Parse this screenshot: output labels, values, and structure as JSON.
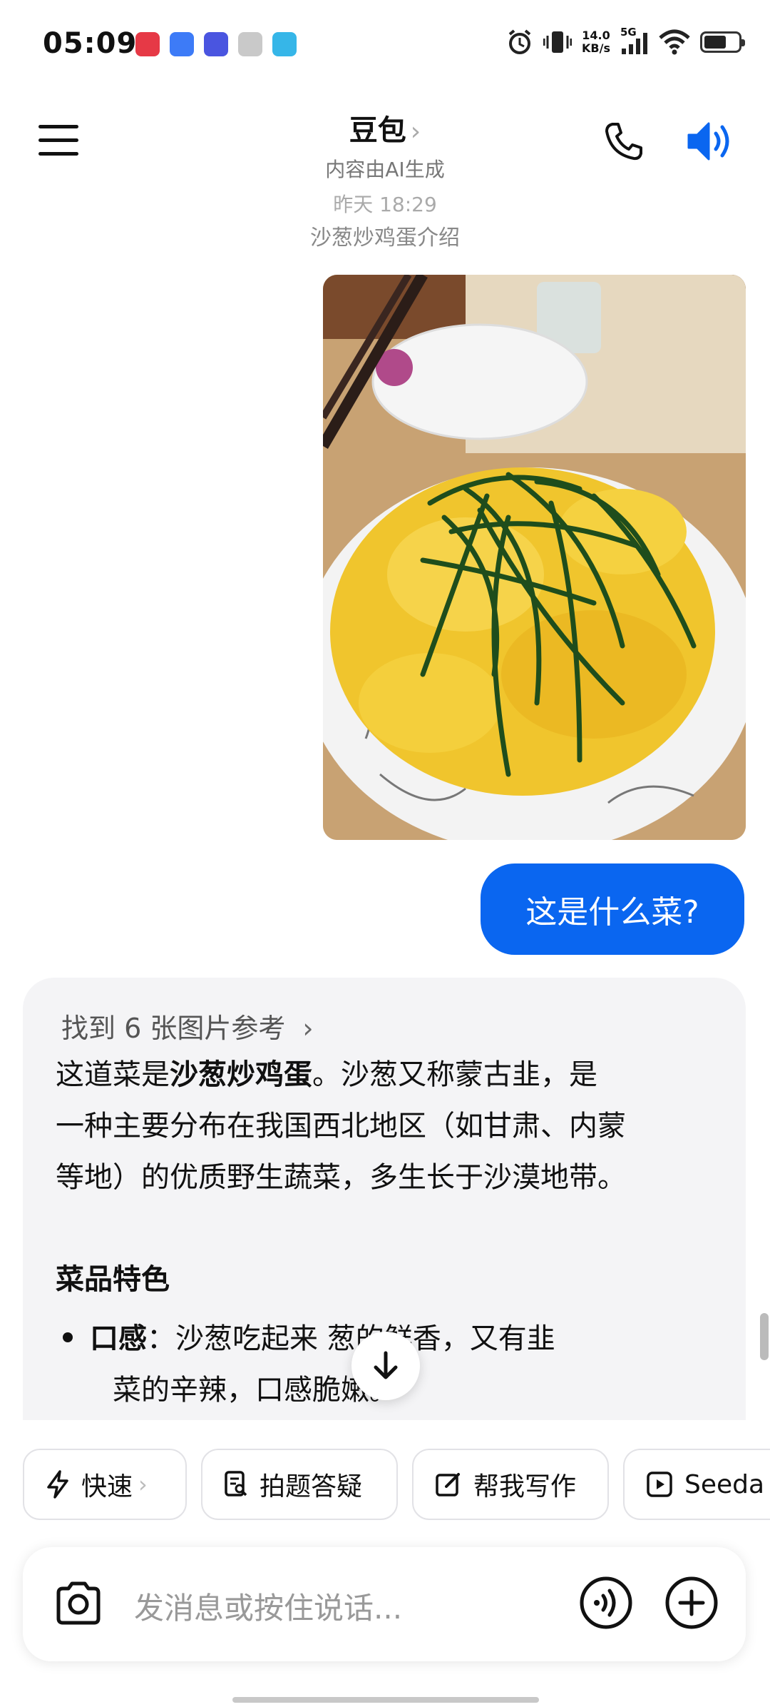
{
  "status_bar": {
    "time": "05:09",
    "net_speed_value": "14.0",
    "net_speed_unit": "KB/s",
    "network_type": "5G",
    "notif_icons": [
      "xiaohongshu-icon",
      "app-blue-icon",
      "vivo-icon",
      "settings-icon",
      "app-cyan-icon"
    ]
  },
  "header": {
    "title": "豆包",
    "title_chevron": "›",
    "subtitle": "内容由AI生成"
  },
  "chat": {
    "date_line": "昨天 18:29",
    "topic": "沙葱炒鸡蛋介绍",
    "user_message": "这是什么菜?",
    "refs_label": "找到 6 张图片参考",
    "answer_intro_1": "这道菜是",
    "answer_bold": "沙葱炒鸡蛋",
    "answer_intro_2": "。沙葱又称蒙古韭，是",
    "answer_line2": "一种主要分布在我国西北地区（如甘肃、内蒙",
    "answer_line3": "等地）的优质野生蔬菜，多生长于沙漠地带。",
    "section_heading": "菜品特色",
    "bullet_label": "口感",
    "bullet_text": "：沙葱吃起来  葱的鲜香，又有韭",
    "bullet_line2": "菜的辛辣，口感脆嫩。"
  },
  "quick_actions": [
    {
      "label": "快速",
      "chevron": "›"
    },
    {
      "label": "拍题答疑"
    },
    {
      "label": "帮我写作"
    },
    {
      "label": "Seeda"
    }
  ],
  "input": {
    "placeholder": "发消息或按住说话..."
  },
  "colors": {
    "accent": "#0a66f0",
    "answer_bg": "#f4f4f6"
  }
}
